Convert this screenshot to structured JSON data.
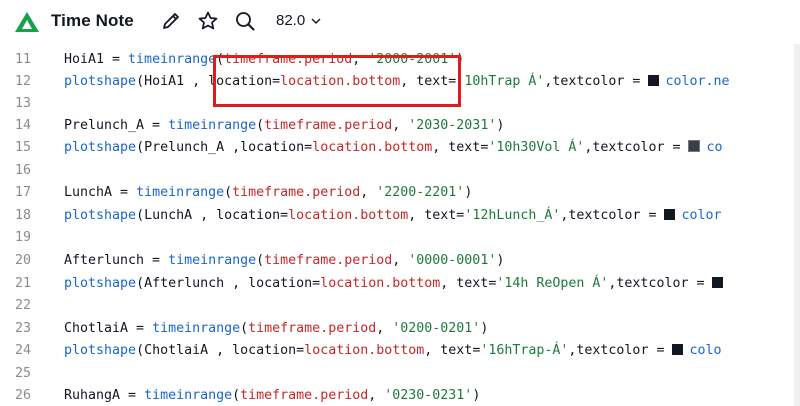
{
  "header": {
    "title": "Time Note",
    "version": "82.0",
    "icons": [
      "logo-icon",
      "pencil-icon",
      "star-icon",
      "search-icon",
      "chevron-down-icon"
    ]
  },
  "colors": {
    "keyword": "#1a66cc",
    "string": "#1d7a3d",
    "timeframe": "#c62828",
    "highlight": "#e01b1b",
    "logo": "#15a34a"
  },
  "code_lines": [
    {
      "n": "11",
      "parts": [
        [
          "HoiA1 = ",
          ""
        ],
        [
          "timeinrange",
          "kw"
        ],
        [
          "(",
          ""
        ],
        [
          "timeframe.period",
          "tf"
        ],
        [
          ", ",
          ""
        ],
        [
          "'2000-2001'",
          "str"
        ],
        [
          ")",
          ""
        ]
      ]
    },
    {
      "n": "12",
      "parts": [
        [
          "plotshape",
          "kw"
        ],
        [
          "(HoiA1 , location=",
          ""
        ],
        [
          "location.bottom",
          "tf"
        ],
        [
          ", text=",
          ""
        ],
        [
          "'10hTrap Á'",
          "str"
        ],
        [
          ",textcolor = ",
          ""
        ],
        [
          "■",
          "swatch"
        ],
        [
          "color.ne",
          "tcolor"
        ]
      ]
    },
    {
      "n": "13",
      "parts": []
    },
    {
      "n": "14",
      "parts": [
        [
          "Prelunch_A = ",
          ""
        ],
        [
          "timeinrange",
          "kw"
        ],
        [
          "(",
          ""
        ],
        [
          "timeframe.period",
          "tf"
        ],
        [
          ", ",
          ""
        ],
        [
          "'2030-2031'",
          "str"
        ],
        [
          ")",
          ""
        ]
      ]
    },
    {
      "n": "15",
      "parts": [
        [
          "plotshape",
          "kw"
        ],
        [
          "(Prelunch_A ,location=",
          ""
        ],
        [
          "location.bottom",
          "tf"
        ],
        [
          ", text=",
          ""
        ],
        [
          "'10h30Vol Á'",
          "str"
        ],
        [
          ",textcolor = ",
          ""
        ],
        [
          "■",
          "swatch-gray"
        ],
        [
          "co",
          "tcolor"
        ]
      ]
    },
    {
      "n": "16",
      "parts": []
    },
    {
      "n": "17",
      "parts": [
        [
          "LunchA = ",
          ""
        ],
        [
          "timeinrange",
          "kw"
        ],
        [
          "(",
          ""
        ],
        [
          "timeframe.period",
          "tf"
        ],
        [
          ", ",
          ""
        ],
        [
          "'2200-2201'",
          "str"
        ],
        [
          ")",
          ""
        ]
      ]
    },
    {
      "n": "18",
      "parts": [
        [
          "plotshape",
          "kw"
        ],
        [
          "(LunchA , location=",
          ""
        ],
        [
          "location.bottom",
          "tf"
        ],
        [
          ", text=",
          ""
        ],
        [
          "'12hLunch_Á'",
          "str"
        ],
        [
          ",textcolor = ",
          ""
        ],
        [
          "■",
          "swatch"
        ],
        [
          "color",
          "tcolor"
        ]
      ]
    },
    {
      "n": "19",
      "parts": []
    },
    {
      "n": "20",
      "parts": [
        [
          "Afterlunch = ",
          ""
        ],
        [
          "timeinrange",
          "kw"
        ],
        [
          "(",
          ""
        ],
        [
          "timeframe.period",
          "tf"
        ],
        [
          ", ",
          ""
        ],
        [
          "'0000-0001'",
          "str"
        ],
        [
          ")",
          ""
        ]
      ]
    },
    {
      "n": "21",
      "parts": [
        [
          "plotshape",
          "kw"
        ],
        [
          "(Afterlunch , location=",
          ""
        ],
        [
          "location.bottom",
          "tf"
        ],
        [
          ", text=",
          ""
        ],
        [
          "'14h ReOpen Á'",
          "str"
        ],
        [
          ",textcolor = ",
          ""
        ],
        [
          "■",
          "swatch"
        ]
      ]
    },
    {
      "n": "22",
      "parts": []
    },
    {
      "n": "23",
      "parts": [
        [
          "ChotlaiA = ",
          ""
        ],
        [
          "timeinrange",
          "kw"
        ],
        [
          "(",
          ""
        ],
        [
          "timeframe.period",
          "tf"
        ],
        [
          ", ",
          ""
        ],
        [
          "'0200-0201'",
          "str"
        ],
        [
          ")",
          ""
        ]
      ]
    },
    {
      "n": "24",
      "parts": [
        [
          "plotshape",
          "kw"
        ],
        [
          "(ChotlaiA , location=",
          ""
        ],
        [
          "location.bottom",
          "tf"
        ],
        [
          ", text=",
          ""
        ],
        [
          "'16hTrap-Á'",
          "str"
        ],
        [
          ",textcolor = ",
          ""
        ],
        [
          "■",
          "swatch"
        ],
        [
          "colo",
          "tcolor"
        ]
      ]
    },
    {
      "n": "25",
      "parts": []
    },
    {
      "n": "26",
      "parts": [
        [
          "RuhangA = ",
          ""
        ],
        [
          "timeinrange",
          "kw"
        ],
        [
          "(",
          ""
        ],
        [
          "timeframe.period",
          "tf"
        ],
        [
          ", ",
          ""
        ],
        [
          "'0230-0231'",
          "str"
        ],
        [
          ")",
          ""
        ]
      ]
    }
  ]
}
